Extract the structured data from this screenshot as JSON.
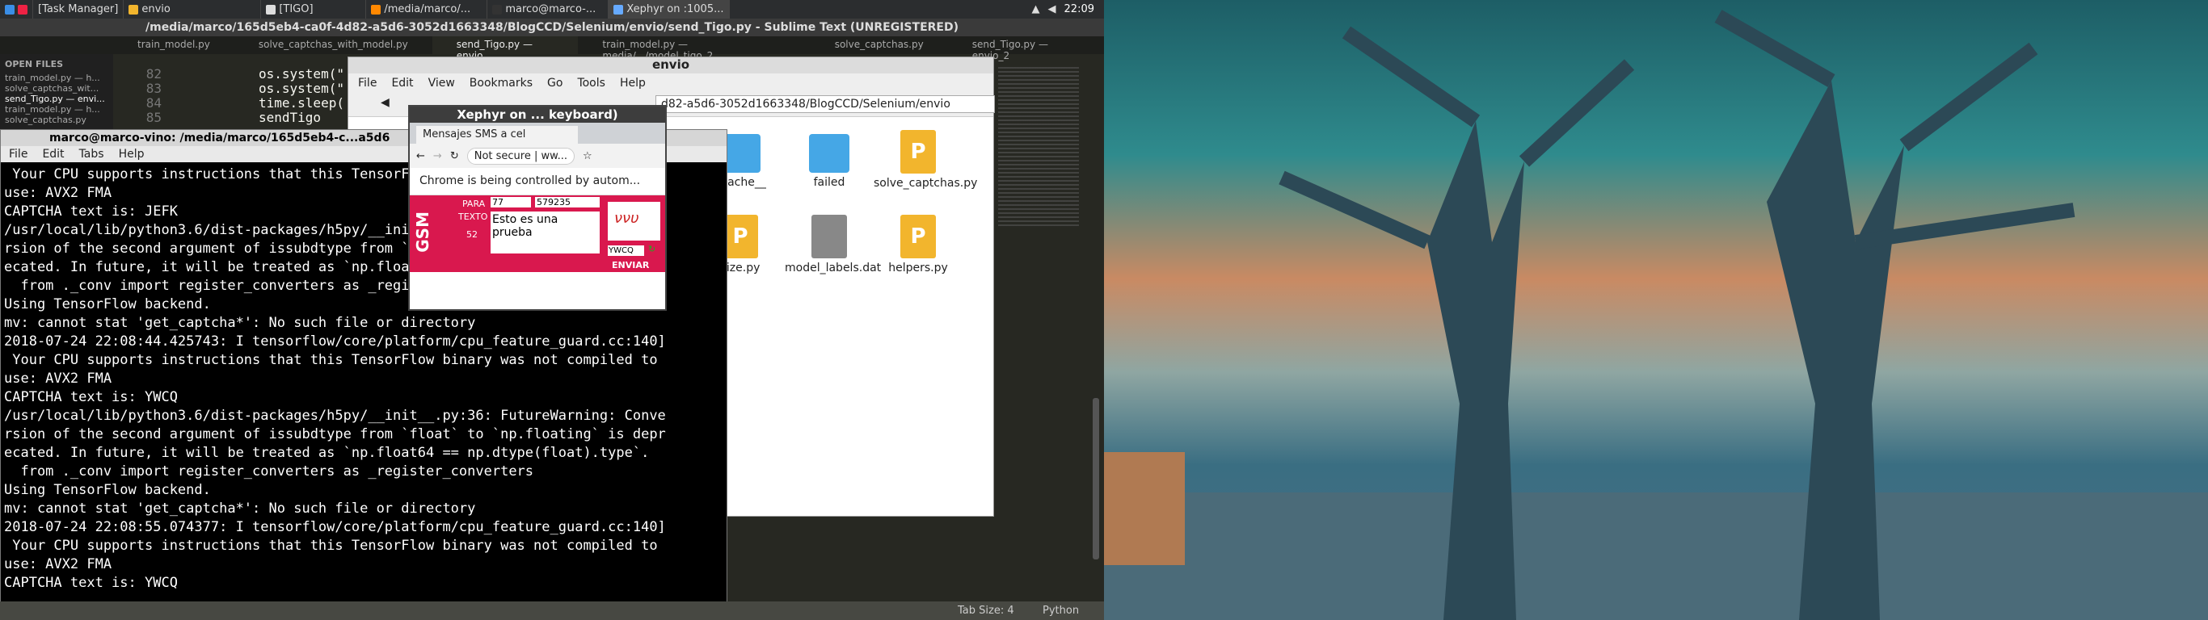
{
  "panel": {
    "items": [
      "[Task Manager]",
      "envio",
      "[TIGO]",
      "/media/marco/...",
      "marco@marco-...",
      "Xephyr on :1005..."
    ],
    "time": "22:09"
  },
  "sublime": {
    "title": "/media/marco/165d5eb4-ca0f-4d82-a5d6-3052d1663348/BlogCCD/Selenium/envio/send_Tigo.py - Sublime Text (UNREGISTERED)",
    "tabs": [
      "train_model.py",
      "solve_captchas_with_model.py",
      "send_Tigo.py — envio",
      "train_model.py — media/.../model_tigo_2",
      "solve_captchas.py",
      "send_Tigo.py — envio_2"
    ],
    "sidebar_header": "OPEN FILES",
    "sidebar_files": [
      "train_model.py — h...",
      "solve_captchas_wit...",
      "send_Tigo.py — envi...",
      "train_model.py — h...",
      "solve_captchas.py"
    ],
    "line_numbers": [
      "82",
      "83",
      "84",
      "85"
    ],
    "code_lines": [
      "os.system(\"",
      "os.system(\"",
      "time.sleep(",
      "sendTigo"
    ],
    "status_tab": "Tab Size: 4",
    "status_lang": "Python"
  },
  "terminal": {
    "title": "marco@marco-vino: /media/marco/165d5eb4-c...a5d6",
    "menu": [
      "File",
      "Edit",
      "Tabs",
      "Help"
    ],
    "lines": [
      " Your CPU supports instructions that this TensorFlow binary was not compiled to",
      "use: AVX2 FMA",
      "CAPTCHA text is: JEFK",
      "/usr/local/lib/python3.6/dist-packages/h5py/__init__.py:36: FutureWarning: Conve",
      "rsion of the second argument of issubdtype from `float` to `np.floating` is depr",
      "ecated. In future, it will be treated as `np.float64 == np.dtype(float).type`.",
      "  from ._conv import register_converters as _register_converters",
      "Using TensorFlow backend.",
      "mv: cannot stat 'get_captcha*': No such file or directory",
      "2018-07-24 22:08:44.425743: I tensorflow/core/platform/cpu_feature_guard.cc:140]",
      " Your CPU supports instructions that this TensorFlow binary was not compiled to",
      "use: AVX2 FMA",
      "CAPTCHA text is: YWCQ",
      "/usr/local/lib/python3.6/dist-packages/h5py/__init__.py:36: FutureWarning: Conve",
      "rsion of the second argument of issubdtype from `float` to `np.floating` is depr",
      "ecated. In future, it will be treated as `np.float64 == np.dtype(float).type`.",
      "  from ._conv import register_converters as _register_converters",
      "Using TensorFlow backend.",
      "mv: cannot stat 'get_captcha*': No such file or directory",
      "2018-07-24 22:08:55.074377: I tensorflow/core/platform/cpu_feature_guard.cc:140]",
      " Your CPU supports instructions that this TensorFlow binary was not compiled to",
      "use: AVX2 FMA",
      "CAPTCHA text is: YWCQ"
    ]
  },
  "filemanager": {
    "title": "envio",
    "menu": [
      "File",
      "Edit",
      "View",
      "Bookmarks",
      "Go",
      "Tools",
      "Help"
    ],
    "location": "d82-a5d6-3052d1663348/BlogCCD/Selenium/envio",
    "files": [
      {
        "name": "ycache__",
        "kind": "folder"
      },
      {
        "name": "failed",
        "kind": "folder"
      },
      {
        "name": "solve_captchas.py",
        "kind": "python"
      },
      {
        "name": "size.py",
        "kind": "python"
      },
      {
        "name": "model_labels.dat",
        "kind": "dat"
      },
      {
        "name": "helpers.py",
        "kind": "python"
      }
    ]
  },
  "xephyr": {
    "title": "Xephyr on ... keyboard)",
    "tab_title": "Mensajes SMS a cel",
    "not_secure": "Not secure",
    "url": "ww...",
    "automation_msg": "Chrome is being controlled by autom...",
    "form_para_label": "PARA",
    "form_para_value": "77",
    "form_number": "579235",
    "form_texto_label": "TEXTO",
    "form_text": "Esto es una prueba",
    "form_count": "52",
    "captcha": "YWCQ",
    "logo_text": "GSM",
    "send_label": "ENVIAR"
  }
}
